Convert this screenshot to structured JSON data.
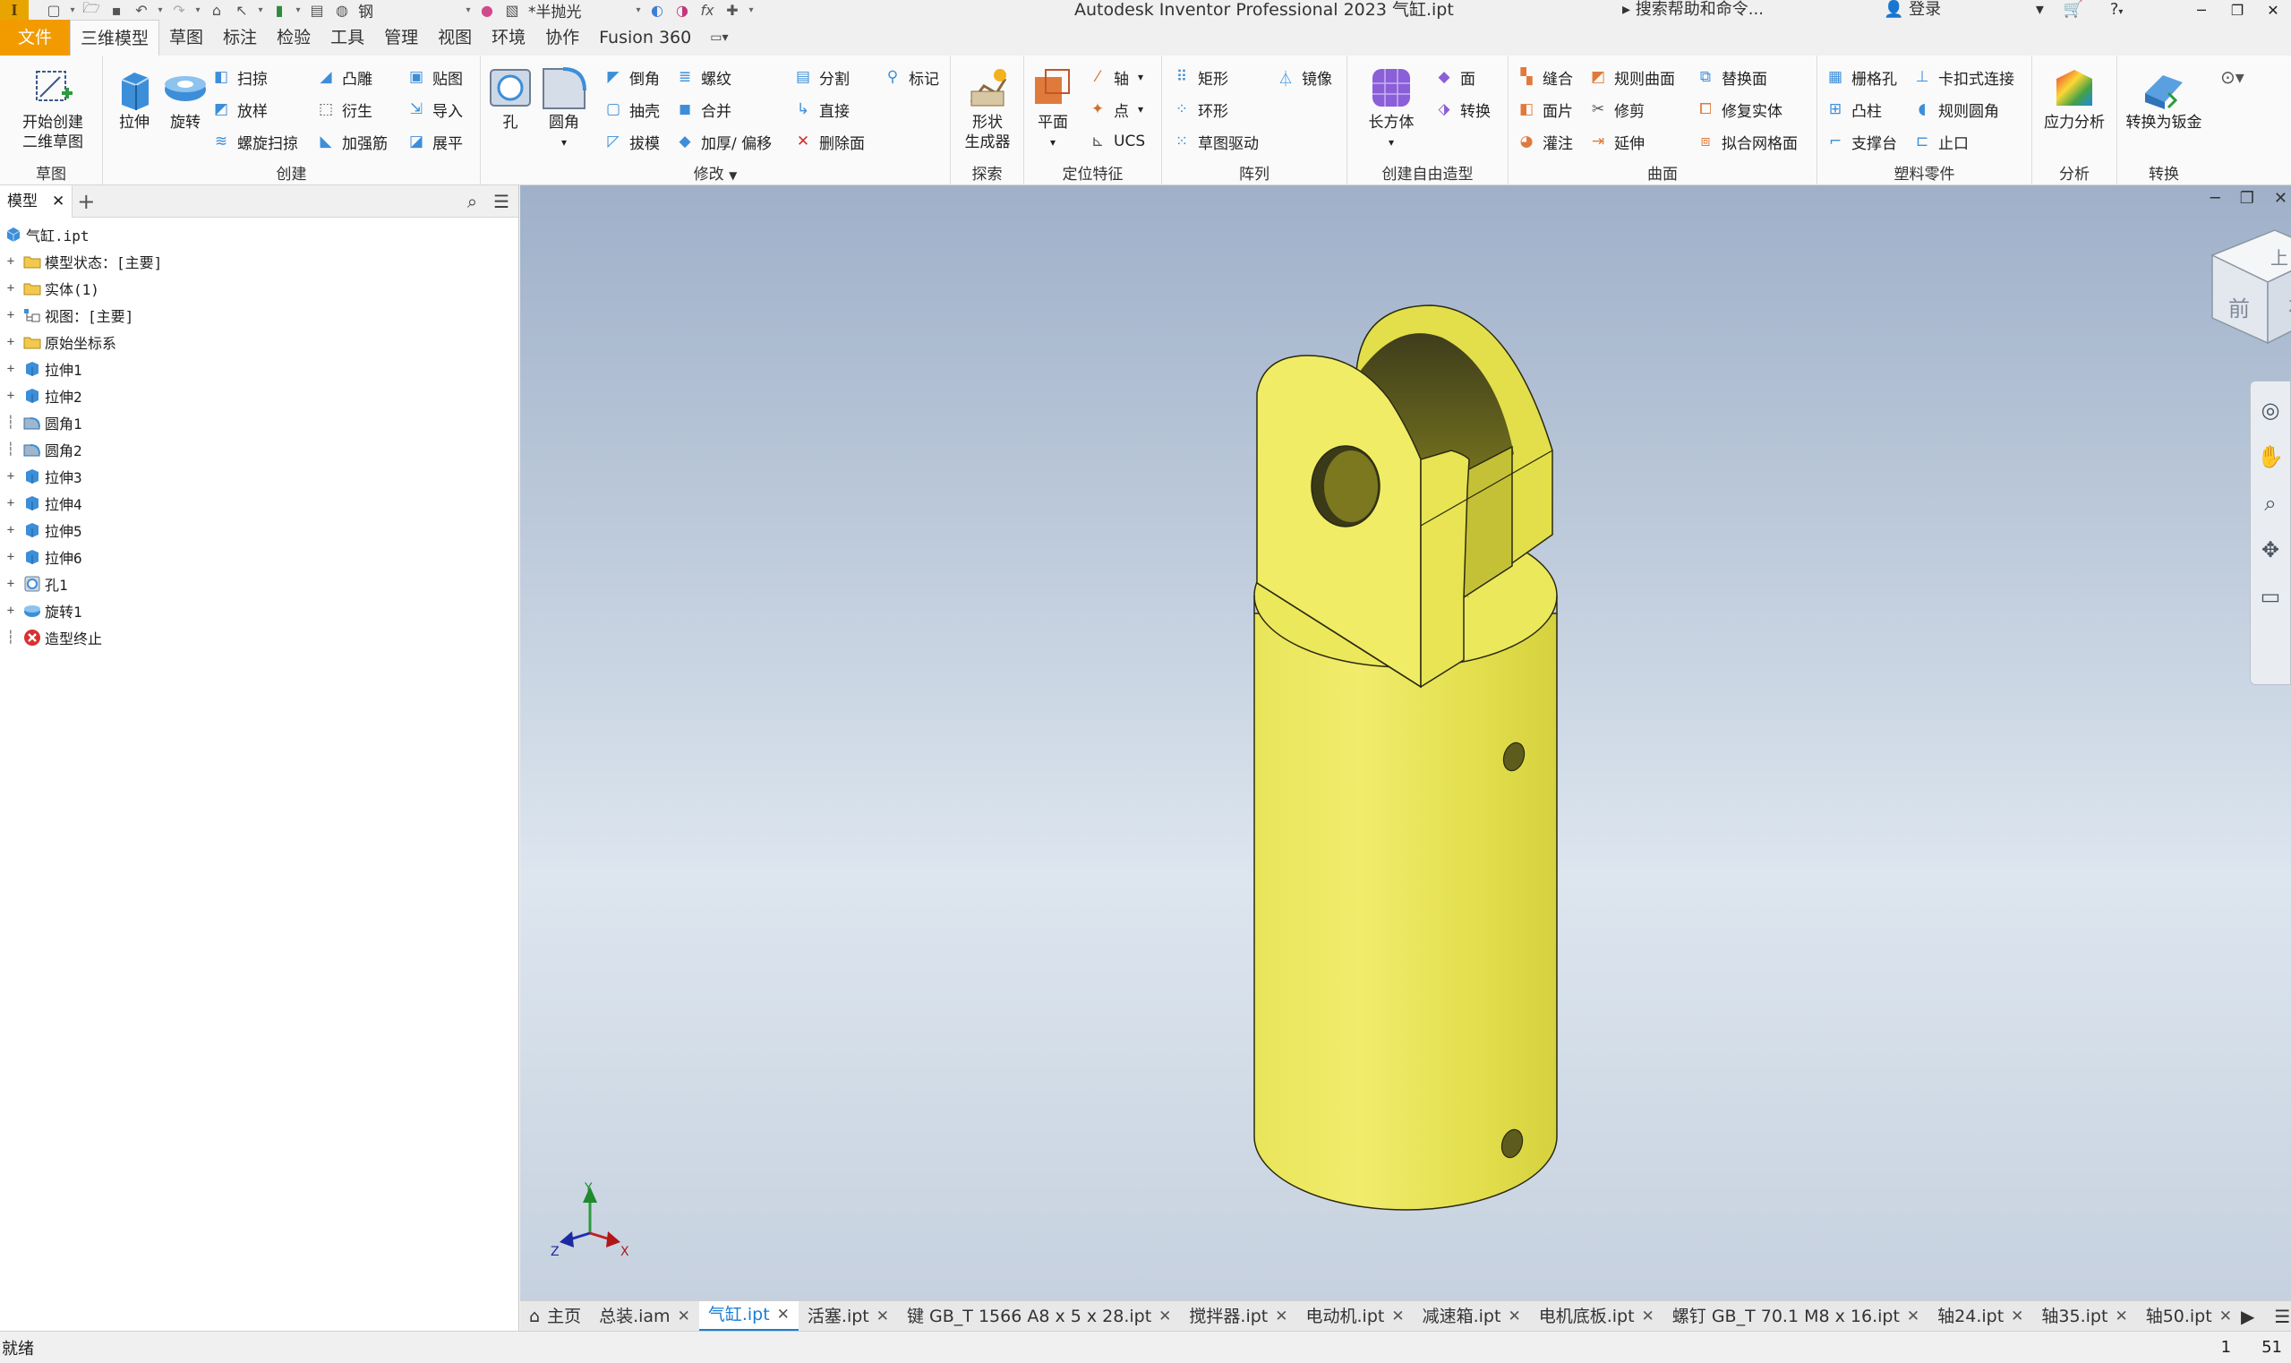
{
  "titlebar": {
    "app_letter": "I",
    "material": "钢",
    "appearance": "*半抛光",
    "title": "Autodesk Inventor Professional 2023    气缸.ipt",
    "search_help": "搜索帮助和命令...",
    "login": "登录",
    "fx": "fx"
  },
  "tabs": [
    {
      "label": "文件"
    },
    {
      "label": "三维模型"
    },
    {
      "label": "草图"
    },
    {
      "label": "标注"
    },
    {
      "label": "检验"
    },
    {
      "label": "工具"
    },
    {
      "label": "管理"
    },
    {
      "label": "视图"
    },
    {
      "label": "环境"
    },
    {
      "label": "协作"
    },
    {
      "label": "Fusion 360"
    }
  ],
  "ribbon": {
    "sketch": {
      "label": "草图",
      "start_sketch_line1": "开始创建",
      "start_sketch_line2": "二维草图"
    },
    "create": {
      "label": "创建",
      "extrude": "拉伸",
      "revolve": "旋转",
      "sweep": "扫掠",
      "loft": "放样",
      "coil": "螺旋扫掠",
      "emboss": "凸雕",
      "derive": "衍生",
      "rib": "加强筋",
      "decal": "贴图",
      "import": "导入",
      "unwrap": "展平"
    },
    "modify": {
      "label": "修改",
      "hole": "孔",
      "fillet": "圆角",
      "chamfer": "倒角",
      "shell": "抽壳",
      "draft": "拔模",
      "thread": "螺纹",
      "combine": "合并",
      "thicken": "加厚/ 偏移",
      "split": "分割",
      "direct": "直接",
      "delete_face": "删除面",
      "mark": "标记"
    },
    "explore": {
      "label": "探索",
      "shape_gen_line1": "形状",
      "shape_gen_line2": "生成器"
    },
    "work_features": {
      "label": "定位特征",
      "plane": "平面",
      "axis": "轴",
      "point": "点",
      "ucs": "UCS"
    },
    "pattern": {
      "label": "阵列",
      "rectangular": "矩形",
      "circular": "环形",
      "sketch_driven": "草图驱动",
      "mirror": "镜像"
    },
    "freeform": {
      "label": "创建自由造型",
      "box": "长方体",
      "face": "面",
      "convert": "转换"
    },
    "surface": {
      "label": "曲面",
      "stitch": "缝合",
      "patch": "面片",
      "sculpt": "灌注",
      "ruled": "规则曲面",
      "trim": "修剪",
      "extend": "延伸",
      "replace_face": "替换面",
      "repair": "修复实体",
      "fit_mesh": "拟合网格面"
    },
    "plastic": {
      "label": "塑料零件",
      "grill": "栅格孔",
      "boss": "凸柱",
      "rest": "支撑台",
      "snap_fit": "卡扣式连接",
      "rule_fillet": "规则圆角",
      "lip": "止口"
    },
    "analysis": {
      "label": "分析",
      "stress": "应力分析"
    },
    "convert": {
      "label": "转换",
      "to_sheet_metal": "转换为钣金"
    }
  },
  "browser": {
    "tab_label": "模型",
    "nodes": [
      {
        "label": "气缸.ipt",
        "icon": "part-icon",
        "expand": false
      },
      {
        "label": "模型状态：[主要]",
        "icon": "folder-icon",
        "expand": true
      },
      {
        "label": "实体(1)",
        "icon": "folder-icon",
        "expand": true
      },
      {
        "label": "视图：[主要]",
        "icon": "view-icon",
        "expand": true
      },
      {
        "label": "原始坐标系",
        "icon": "folder-icon",
        "expand": true
      },
      {
        "label": "拉伸1",
        "icon": "extrude-icon",
        "expand": true
      },
      {
        "label": "拉伸2",
        "icon": "extrude-icon",
        "expand": true
      },
      {
        "label": "圆角1",
        "icon": "fillet-icon",
        "expand": false
      },
      {
        "label": "圆角2",
        "icon": "fillet-icon",
        "expand": false
      },
      {
        "label": "拉伸3",
        "icon": "extrude-icon",
        "expand": true
      },
      {
        "label": "拉伸4",
        "icon": "extrude-icon",
        "expand": true
      },
      {
        "label": "拉伸5",
        "icon": "extrude-icon",
        "expand": true
      },
      {
        "label": "拉伸6",
        "icon": "extrude-icon",
        "expand": true
      },
      {
        "label": "孔1",
        "icon": "hole-icon",
        "expand": true
      },
      {
        "label": "旋转1",
        "icon": "revolve-icon",
        "expand": true
      },
      {
        "label": "造型终止",
        "icon": "end-of-part-icon",
        "expand": false
      }
    ]
  },
  "viewcube": {
    "top": "上",
    "front": "前",
    "right": "右"
  },
  "triad": {
    "x": "X",
    "y": "Y",
    "z": "Z"
  },
  "doc_tabs": [
    {
      "label": "主页",
      "close": false,
      "active": false
    },
    {
      "label": "总装.iam",
      "close": true,
      "active": false
    },
    {
      "label": "气缸.ipt",
      "close": true,
      "active": true
    },
    {
      "label": "活塞.ipt",
      "close": true,
      "active": false
    },
    {
      "label": "键 GB_T 1566 A8 x 5 x 28.ipt",
      "close": true,
      "active": false
    },
    {
      "label": "搅拌器.ipt",
      "close": true,
      "active": false
    },
    {
      "label": "电动机.ipt",
      "close": true,
      "active": false
    },
    {
      "label": "减速箱.ipt",
      "close": true,
      "active": false
    },
    {
      "label": "电机底板.ipt",
      "close": true,
      "active": false
    },
    {
      "label": "螺钉 GB_T 70.1 M8 x 16.ipt",
      "close": true,
      "active": false
    },
    {
      "label": "轴24.ipt",
      "close": true,
      "active": false
    },
    {
      "label": "轴35.ipt",
      "close": true,
      "active": false
    },
    {
      "label": "轴50.ipt",
      "close": true,
      "active": false
    }
  ],
  "status": {
    "text": "就绪",
    "count1": "1",
    "count2": "51"
  },
  "colors": {
    "accent": "#f29b00",
    "part_yellow": "#eeea5a",
    "active_tab": "#1a7dd4"
  }
}
